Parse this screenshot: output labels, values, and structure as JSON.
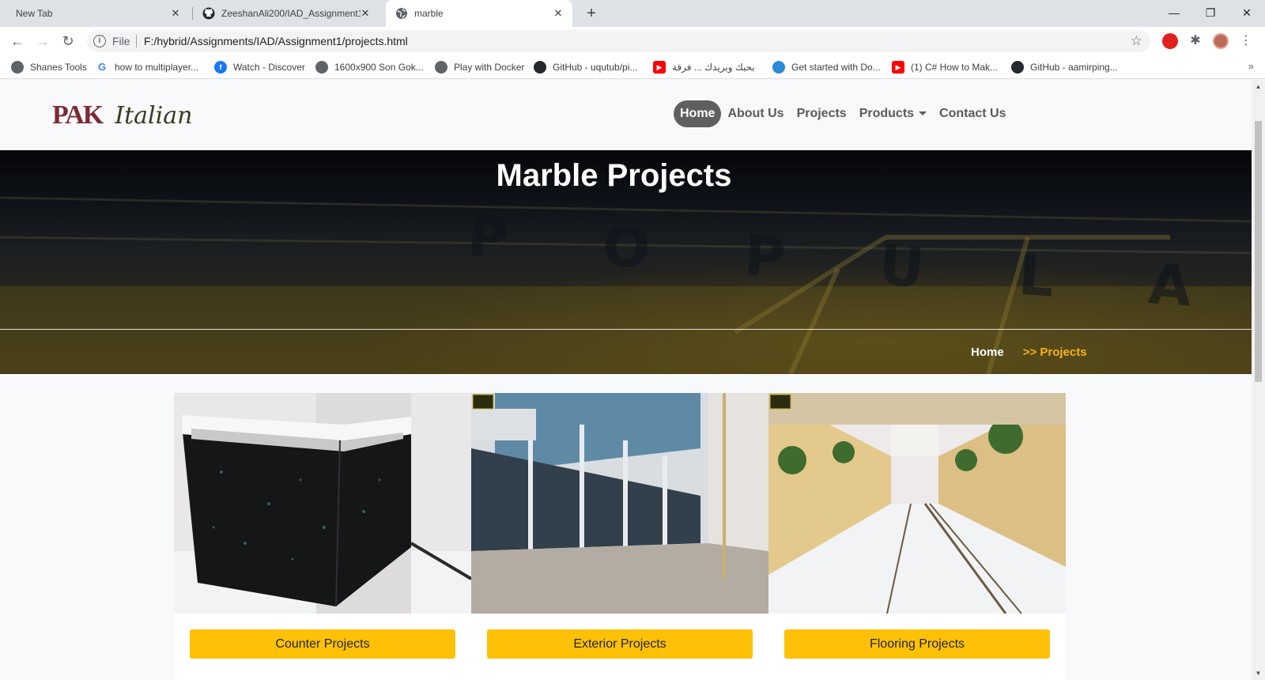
{
  "browser": {
    "tabs": [
      {
        "label": "New Tab"
      },
      {
        "label": "ZeeshanAli200/IAD_Assignment1"
      },
      {
        "label": "marble"
      }
    ],
    "address": {
      "scheme_label": "File",
      "url": "F:/hybrid/Assignments/IAD/Assignment1/projects.html"
    },
    "bookmarks": [
      {
        "label": "Shanes Tools"
      },
      {
        "label": "how to multiplayer..."
      },
      {
        "label": "Watch - Discover"
      },
      {
        "label": "1600x900 Son Gok..."
      },
      {
        "label": "Play with Docker"
      },
      {
        "label": "GitHub - uqutub/pi..."
      },
      {
        "label": "بحبك وبريدك ... فرقة"
      },
      {
        "label": "Get started with Do..."
      },
      {
        "label": "(1) C# How to Mak..."
      },
      {
        "label": "GitHub - aamirping..."
      }
    ]
  },
  "site": {
    "logo": {
      "brand": "PAK",
      "script": "Italian"
    },
    "nav": [
      {
        "label": "Home"
      },
      {
        "label": "About Us"
      },
      {
        "label": "Projects"
      },
      {
        "label": "Products"
      },
      {
        "label": "Contact Us"
      }
    ],
    "hero": {
      "title": "Marble Projects",
      "breadcrumb_home": "Home",
      "breadcrumb_current": ">> Projects",
      "background_text": "POPULAR"
    },
    "projects": [
      {
        "label": "Counter Projects"
      },
      {
        "label": "Exterior Projects"
      },
      {
        "label": "Flooring Projects"
      }
    ]
  }
}
